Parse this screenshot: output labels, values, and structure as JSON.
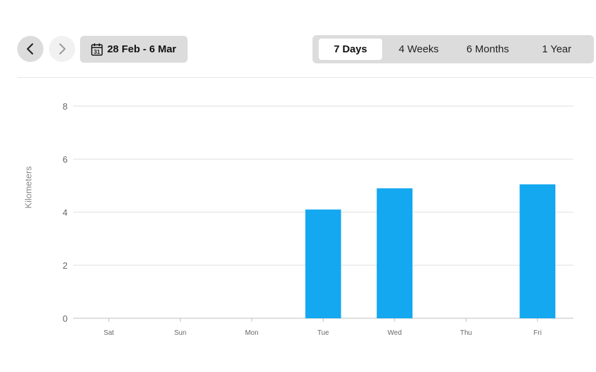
{
  "toolbar": {
    "prev_icon": "chevron-left-icon",
    "next_icon": "chevron-right-icon",
    "calendar_icon": "calendar-icon",
    "calendar_day": "31",
    "date_range": "28 Feb - 6 Mar",
    "tabs": [
      {
        "label": "7 Days",
        "active": true
      },
      {
        "label": "4 Weeks",
        "active": false
      },
      {
        "label": "6 Months",
        "active": false
      },
      {
        "label": "1 Year",
        "active": false
      }
    ]
  },
  "colors": {
    "bar": "#13a8ef",
    "grid": "#dcdcdc",
    "axis": "#bdbdbd",
    "tick_text": "#666666"
  },
  "chart_data": {
    "type": "bar",
    "categories": [
      "Sat",
      "Sun",
      "Mon",
      "Tue",
      "Wed",
      "Thu",
      "Fri"
    ],
    "values": [
      0,
      0,
      0,
      4.1,
      4.9,
      0,
      5.05
    ],
    "ylabel": "Kilometers",
    "ylim": [
      0,
      8
    ],
    "yticks": [
      0,
      2,
      4,
      6,
      8
    ],
    "grid": true
  }
}
